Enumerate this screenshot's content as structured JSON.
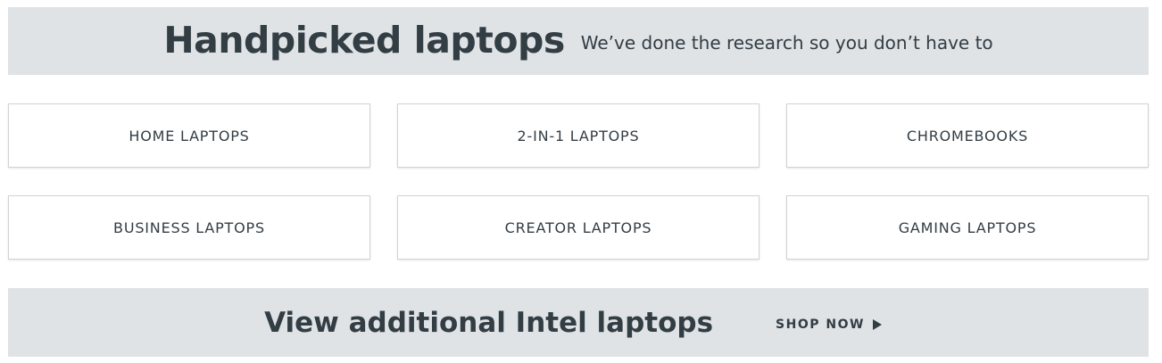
{
  "hero": {
    "title": "Handpicked laptops",
    "subtitle": "We’ve done the research so you don’t have to"
  },
  "categories": [
    {
      "label": "HOME LAPTOPS"
    },
    {
      "label": "2-IN-1 LAPTOPS"
    },
    {
      "label": "CHROMEBOOKS"
    },
    {
      "label": "BUSINESS LAPTOPS"
    },
    {
      "label": "CREATOR LAPTOPS"
    },
    {
      "label": "GAMING LAPTOPS"
    }
  ],
  "footer": {
    "title": "View additional Intel laptops",
    "cta_label": "SHOP NOW",
    "cta_icon": "play-icon"
  },
  "colors": {
    "banner_bg": "#dfe3e6",
    "text": "#333d44",
    "card_border": "#cfd4d7"
  }
}
